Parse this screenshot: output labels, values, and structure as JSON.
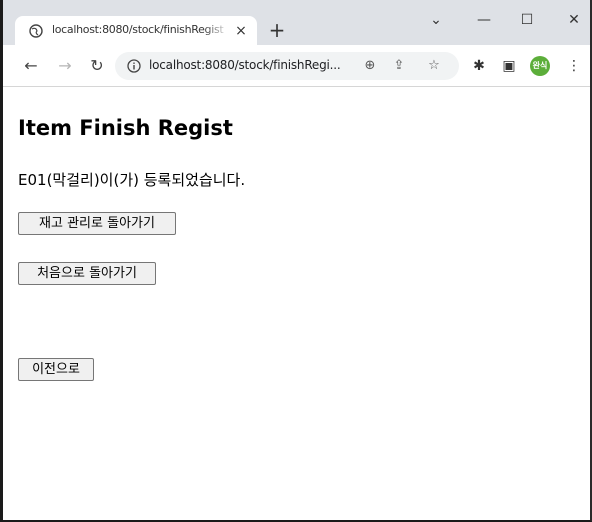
{
  "browser": {
    "tab_title": "localhost:8080/stock/finishRegist",
    "tab_close": "×",
    "new_tab": "+",
    "window_controls": {
      "chevron": "⌄",
      "minimize": "—",
      "maximize": "☐",
      "close": "✕"
    },
    "nav": {
      "back": "←",
      "forward": "→",
      "reload": "↻"
    },
    "url": "localhost:8080/stock/finishRegi...",
    "omnibox_icons": {
      "zoom": "⊕",
      "share": "⇪",
      "bookmark": "☆"
    },
    "toolbar_icons": {
      "extensions": "✱",
      "side_panel": "▣",
      "menu": "⋮"
    },
    "profile_label": "완식",
    "profile_color": "#5cae3a"
  },
  "page": {
    "title": "Item Finish Regist",
    "message": "E01(막걸리)이(가) 등록되었습니다.",
    "buttons": {
      "stock_manage": "재고 관리로 돌아가기",
      "home": "처음으로 돌아가기",
      "back": "이전으로"
    }
  }
}
